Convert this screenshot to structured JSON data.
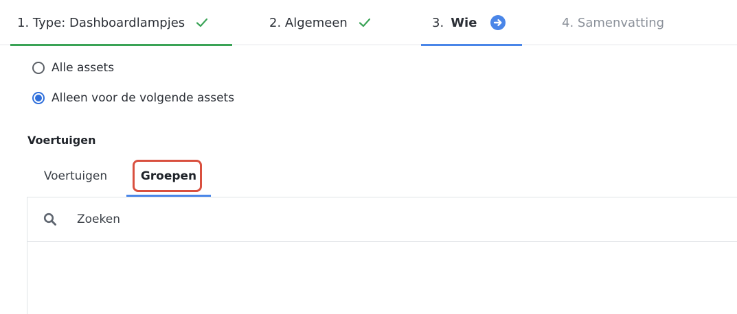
{
  "stepper": {
    "steps": [
      {
        "number": "1.",
        "label": "Type: Dashboardlampjes",
        "status": "completed"
      },
      {
        "number": "2.",
        "label": "Algemeen",
        "status": "completed"
      },
      {
        "number": "3.",
        "label": "Wie",
        "status": "current"
      },
      {
        "number": "4.",
        "label": "Samenvatting",
        "status": "upcoming"
      }
    ],
    "colors": {
      "completed": "#3aa356",
      "current": "#4a86e8",
      "upcoming": "#8a9099"
    }
  },
  "scope": {
    "options": [
      {
        "label": "Alle assets",
        "selected": false
      },
      {
        "label": "Alleen voor de volgende assets",
        "selected": true
      }
    ]
  },
  "section": {
    "heading": "Voertuigen"
  },
  "tabs": [
    {
      "label": "Voertuigen",
      "active": false
    },
    {
      "label": "Groepen",
      "active": true
    }
  ],
  "search": {
    "placeholder": "Zoeken",
    "value": "",
    "icon": "search-icon"
  },
  "annotation": {
    "highlight_color": "#d9503f"
  }
}
